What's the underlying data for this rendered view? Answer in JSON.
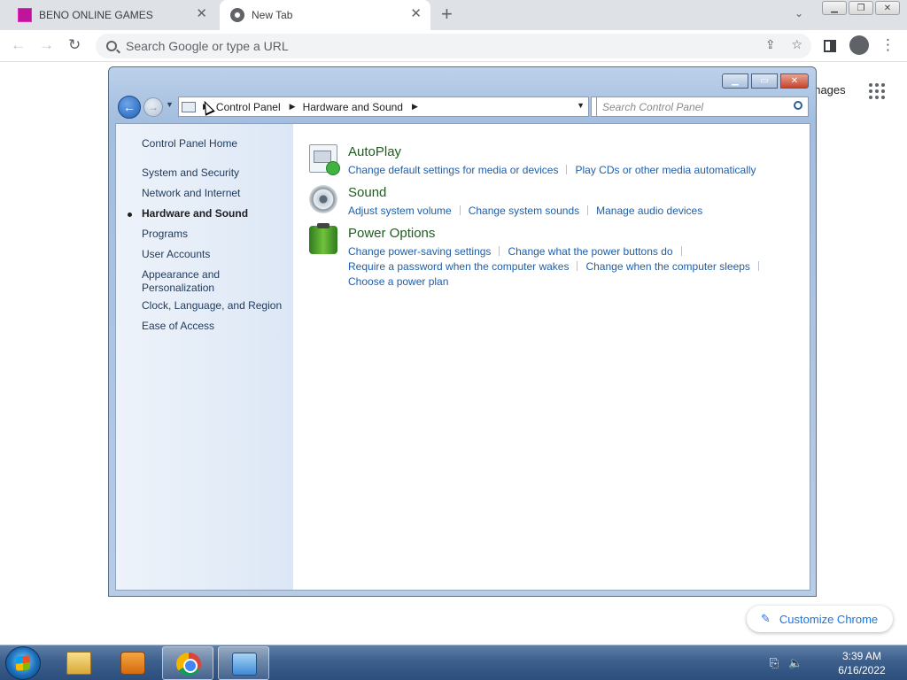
{
  "browser": {
    "tabs": [
      {
        "title": "BENO ONLINE GAMES",
        "icon": "beno-favicon"
      },
      {
        "title": "New Tab",
        "icon": "chrome-favicon"
      }
    ],
    "omnibox_placeholder": "Search Google or type a URL",
    "ntp_images_link": "Images",
    "customize_label": "Customize Chrome"
  },
  "control_panel": {
    "breadcrumb": [
      "Control Panel",
      "Hardware and Sound"
    ],
    "search_placeholder": "Search Control Panel",
    "sidebar": [
      "Control Panel Home",
      "System and Security",
      "Network and Internet",
      "Hardware and Sound",
      "Programs",
      "User Accounts",
      "Appearance and Personalization",
      "Clock, Language, and Region",
      "Ease of Access"
    ],
    "active_sidebar_item": "Hardware and Sound",
    "categories": [
      {
        "title": "AutoPlay",
        "icon": "autoplay-icon",
        "links": [
          "Change default settings for media or devices",
          "Play CDs or other media automatically"
        ]
      },
      {
        "title": "Sound",
        "icon": "speaker-icon",
        "links": [
          "Adjust system volume",
          "Change system sounds",
          "Manage audio devices"
        ]
      },
      {
        "title": "Power Options",
        "icon": "battery-icon",
        "links": [
          "Change power-saving settings",
          "Change what the power buttons do",
          "Require a password when the computer wakes",
          "Change when the computer sleeps",
          "Choose a power plan"
        ]
      }
    ]
  },
  "taskbar": {
    "time": "3:39 AM",
    "date": "6/16/2022"
  },
  "colors": {
    "link": "#1f5ea8",
    "category_title": "#1e5d1e",
    "taskbar": "#3d5f8c"
  }
}
